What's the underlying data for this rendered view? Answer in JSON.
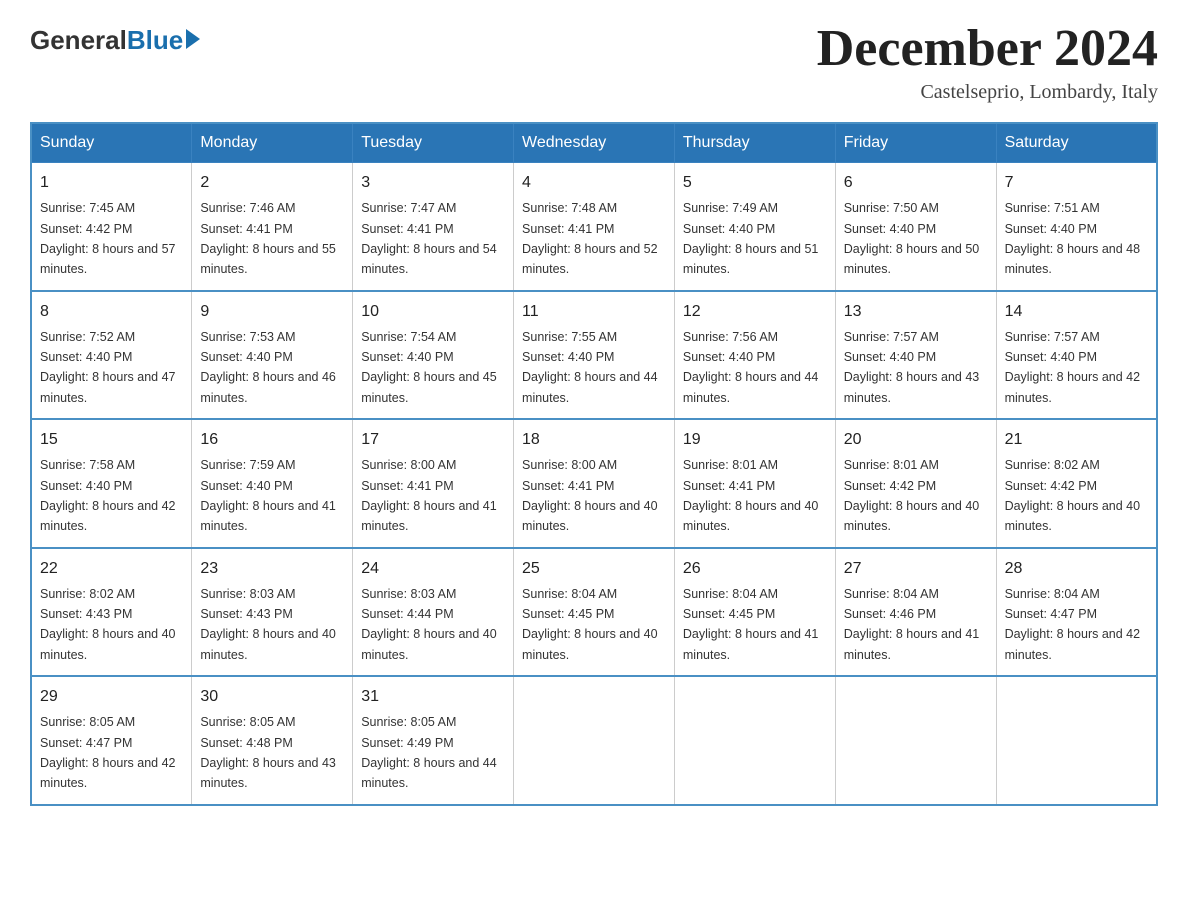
{
  "header": {
    "logo_general": "General",
    "logo_blue": "Blue",
    "month_title": "December 2024",
    "location": "Castelseprio, Lombardy, Italy"
  },
  "days_of_week": [
    "Sunday",
    "Monday",
    "Tuesday",
    "Wednesday",
    "Thursday",
    "Friday",
    "Saturday"
  ],
  "weeks": [
    [
      {
        "day": "1",
        "sunrise": "7:45 AM",
        "sunset": "4:42 PM",
        "daylight": "8 hours and 57 minutes."
      },
      {
        "day": "2",
        "sunrise": "7:46 AM",
        "sunset": "4:41 PM",
        "daylight": "8 hours and 55 minutes."
      },
      {
        "day": "3",
        "sunrise": "7:47 AM",
        "sunset": "4:41 PM",
        "daylight": "8 hours and 54 minutes."
      },
      {
        "day": "4",
        "sunrise": "7:48 AM",
        "sunset": "4:41 PM",
        "daylight": "8 hours and 52 minutes."
      },
      {
        "day": "5",
        "sunrise": "7:49 AM",
        "sunset": "4:40 PM",
        "daylight": "8 hours and 51 minutes."
      },
      {
        "day": "6",
        "sunrise": "7:50 AM",
        "sunset": "4:40 PM",
        "daylight": "8 hours and 50 minutes."
      },
      {
        "day": "7",
        "sunrise": "7:51 AM",
        "sunset": "4:40 PM",
        "daylight": "8 hours and 48 minutes."
      }
    ],
    [
      {
        "day": "8",
        "sunrise": "7:52 AM",
        "sunset": "4:40 PM",
        "daylight": "8 hours and 47 minutes."
      },
      {
        "day": "9",
        "sunrise": "7:53 AM",
        "sunset": "4:40 PM",
        "daylight": "8 hours and 46 minutes."
      },
      {
        "day": "10",
        "sunrise": "7:54 AM",
        "sunset": "4:40 PM",
        "daylight": "8 hours and 45 minutes."
      },
      {
        "day": "11",
        "sunrise": "7:55 AM",
        "sunset": "4:40 PM",
        "daylight": "8 hours and 44 minutes."
      },
      {
        "day": "12",
        "sunrise": "7:56 AM",
        "sunset": "4:40 PM",
        "daylight": "8 hours and 44 minutes."
      },
      {
        "day": "13",
        "sunrise": "7:57 AM",
        "sunset": "4:40 PM",
        "daylight": "8 hours and 43 minutes."
      },
      {
        "day": "14",
        "sunrise": "7:57 AM",
        "sunset": "4:40 PM",
        "daylight": "8 hours and 42 minutes."
      }
    ],
    [
      {
        "day": "15",
        "sunrise": "7:58 AM",
        "sunset": "4:40 PM",
        "daylight": "8 hours and 42 minutes."
      },
      {
        "day": "16",
        "sunrise": "7:59 AM",
        "sunset": "4:40 PM",
        "daylight": "8 hours and 41 minutes."
      },
      {
        "day": "17",
        "sunrise": "8:00 AM",
        "sunset": "4:41 PM",
        "daylight": "8 hours and 41 minutes."
      },
      {
        "day": "18",
        "sunrise": "8:00 AM",
        "sunset": "4:41 PM",
        "daylight": "8 hours and 40 minutes."
      },
      {
        "day": "19",
        "sunrise": "8:01 AM",
        "sunset": "4:41 PM",
        "daylight": "8 hours and 40 minutes."
      },
      {
        "day": "20",
        "sunrise": "8:01 AM",
        "sunset": "4:42 PM",
        "daylight": "8 hours and 40 minutes."
      },
      {
        "day": "21",
        "sunrise": "8:02 AM",
        "sunset": "4:42 PM",
        "daylight": "8 hours and 40 minutes."
      }
    ],
    [
      {
        "day": "22",
        "sunrise": "8:02 AM",
        "sunset": "4:43 PM",
        "daylight": "8 hours and 40 minutes."
      },
      {
        "day": "23",
        "sunrise": "8:03 AM",
        "sunset": "4:43 PM",
        "daylight": "8 hours and 40 minutes."
      },
      {
        "day": "24",
        "sunrise": "8:03 AM",
        "sunset": "4:44 PM",
        "daylight": "8 hours and 40 minutes."
      },
      {
        "day": "25",
        "sunrise": "8:04 AM",
        "sunset": "4:45 PM",
        "daylight": "8 hours and 40 minutes."
      },
      {
        "day": "26",
        "sunrise": "8:04 AM",
        "sunset": "4:45 PM",
        "daylight": "8 hours and 41 minutes."
      },
      {
        "day": "27",
        "sunrise": "8:04 AM",
        "sunset": "4:46 PM",
        "daylight": "8 hours and 41 minutes."
      },
      {
        "day": "28",
        "sunrise": "8:04 AM",
        "sunset": "4:47 PM",
        "daylight": "8 hours and 42 minutes."
      }
    ],
    [
      {
        "day": "29",
        "sunrise": "8:05 AM",
        "sunset": "4:47 PM",
        "daylight": "8 hours and 42 minutes."
      },
      {
        "day": "30",
        "sunrise": "8:05 AM",
        "sunset": "4:48 PM",
        "daylight": "8 hours and 43 minutes."
      },
      {
        "day": "31",
        "sunrise": "8:05 AM",
        "sunset": "4:49 PM",
        "daylight": "8 hours and 44 minutes."
      },
      null,
      null,
      null,
      null
    ]
  ]
}
